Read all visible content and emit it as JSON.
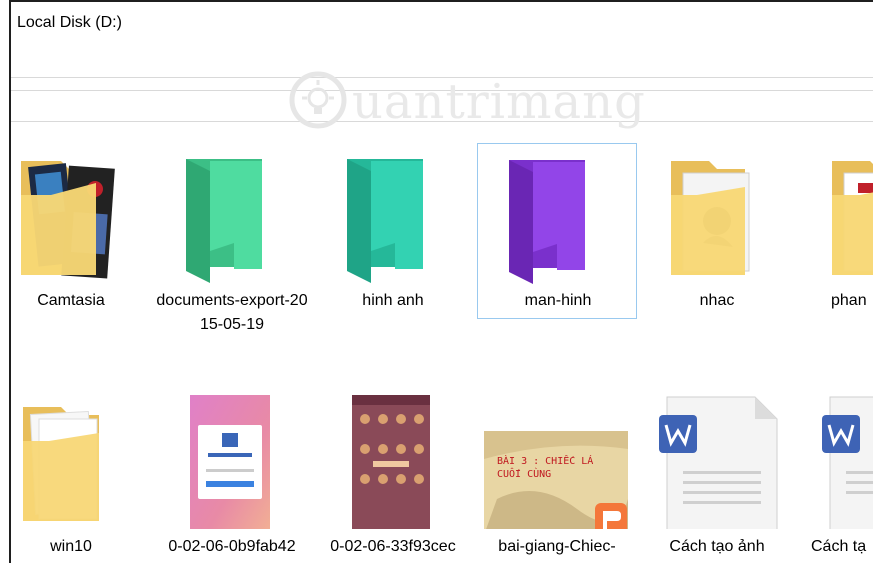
{
  "window": {
    "title": "Local Disk (D:)"
  },
  "watermark": {
    "text": "uantrimang"
  },
  "colors": {
    "folder_yellow": "#f8d775",
    "folder_green": "#46d69a",
    "folder_teal": "#2ccfae",
    "folder_purple": "#8a3ee0",
    "selection_border": "#99c9ef",
    "word_blue": "#3e63b5",
    "ppt_orange": "#f4773a"
  },
  "row1": [
    {
      "label": "Camtasia",
      "icon": "folder-with-images-icon"
    },
    {
      "label": "documents-export-2015-05-19",
      "icon": "green-folder-icon"
    },
    {
      "label": "hinh anh",
      "icon": "teal-folder-icon"
    },
    {
      "label": "man-hinh",
      "icon": "purple-folder-icon",
      "selected": true
    },
    {
      "label": "nhac",
      "icon": "folder-with-image-icon"
    },
    {
      "label": "phan",
      "icon": "folder-with-image-icon"
    }
  ],
  "row2": [
    {
      "label": "win10",
      "icon": "folder-with-documents-icon"
    },
    {
      "label": "0-02-06-0b9fab42",
      "icon": "image-thumbnail-icon"
    },
    {
      "label": "0-02-06-33f93cec",
      "icon": "image-thumbnail-icon"
    },
    {
      "label": "bai-giang-Chiec-",
      "icon": "presentation-thumbnail-icon",
      "slide_text": "BÀI 3 : CHIẾC LÁ CUỐI CÙNG"
    },
    {
      "label": "Cách tạo ảnh",
      "icon": "word-document-icon"
    },
    {
      "label": "Cách tạ",
      "icon": "word-document-icon"
    }
  ]
}
